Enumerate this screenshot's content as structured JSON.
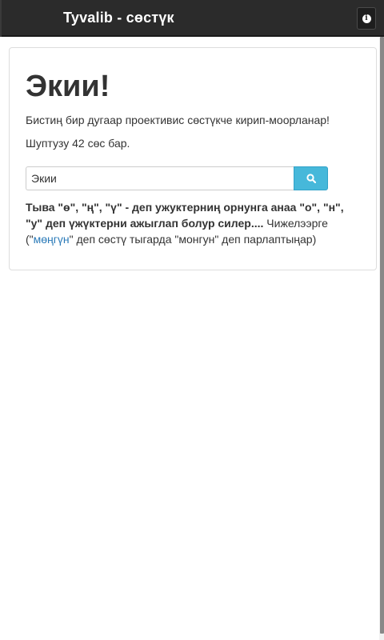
{
  "navbar": {
    "brand": "Tyvalib - сөстүк",
    "info_icon": "info-circle-icon"
  },
  "main": {
    "heading": "Экии!",
    "intro": "Бистиң бир дугаар проективис сөстүкче кирип-моорланар!",
    "word_count": "Шуптузу 42 сөс бар.",
    "search": {
      "value": "Экии",
      "icon": "search-icon"
    },
    "note": {
      "bold": "Тыва \"ө\", \"ң\", \"ү\" - деп ужуктерниң орнунга анаа \"о\", \"н\", \"у\" деп үжүктерни ажыглап болур силер....",
      "text_before": " Чижелээрге (\"",
      "link": "мөңгүн",
      "text_after": "\" деп сөстү тыгарда \"монгун\" деп парлаптыңар)"
    }
  },
  "colors": {
    "navbar_bg": "#2b2b2b",
    "search_button": "#46b8da",
    "link": "#2a7ab8"
  }
}
